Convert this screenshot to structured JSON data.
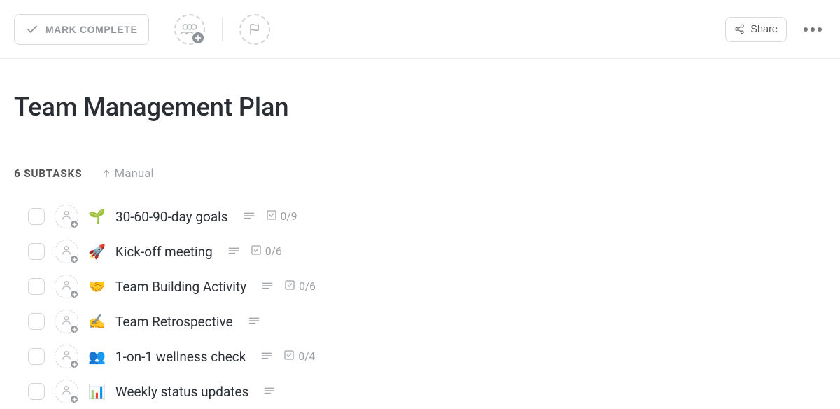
{
  "toolbar": {
    "mark_complete_label": "MARK COMPLETE",
    "share_label": "Share"
  },
  "title": "Team Management Plan",
  "subtasks_bar": {
    "count_label": "6 SUBTASKS",
    "sort_label": "Manual"
  },
  "tasks": [
    {
      "emoji": "🌱",
      "name": "30-60-90-day goals",
      "has_description": true,
      "checklist": "0/9"
    },
    {
      "emoji": "🚀",
      "name": "Kick-off meeting",
      "has_description": true,
      "checklist": "0/6"
    },
    {
      "emoji": "🤝",
      "name": "Team Building Activity",
      "has_description": true,
      "checklist": "0/6"
    },
    {
      "emoji": "✍️",
      "name": "Team Retrospective",
      "has_description": true,
      "checklist": null
    },
    {
      "emoji": "👥",
      "name": "1-on-1 wellness check",
      "has_description": true,
      "checklist": "0/4"
    },
    {
      "emoji": "📊",
      "name": "Weekly status updates",
      "has_description": true,
      "checklist": null
    }
  ]
}
